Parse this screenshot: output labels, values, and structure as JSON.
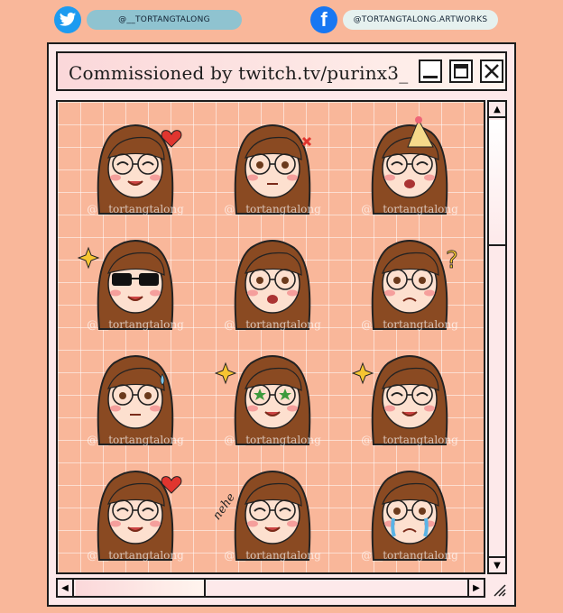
{
  "social": {
    "twitter_handle": "@__TORTANGTALONG",
    "facebook_handle": "@TORTANGTALONG.ARTWORKS",
    "twitter_icon": "twitter-bird-icon",
    "facebook_icon": "facebook-f-icon"
  },
  "window": {
    "title": "Commissioned by twitch.tv/purinx3_",
    "watermark": "@__tortangtalong"
  },
  "colors": {
    "background": "#f9b79a",
    "window": "#fde9ea",
    "hair": "#8a4a22",
    "skin": "#fde0cf",
    "blush": "#f28f8f",
    "heart": "#e0352f",
    "sparkle": "#f6c531"
  },
  "emotes": [
    {
      "name": "heart-cat",
      "mouth": "smile",
      "eyes": "closed",
      "accessory": "heart"
    },
    {
      "name": "angry",
      "mouth": "flat",
      "eyes": "open",
      "accessory": "anger"
    },
    {
      "name": "party",
      "mouth": "open",
      "eyes": "closed",
      "accessory": "hat"
    },
    {
      "name": "cool",
      "mouth": "smile",
      "eyes": "sunglasses",
      "accessory": "sparkle"
    },
    {
      "name": "shocked",
      "mouth": "open",
      "eyes": "open",
      "accessory": "none"
    },
    {
      "name": "confused-cat",
      "mouth": "frown",
      "eyes": "open",
      "accessory": "question"
    },
    {
      "name": "nervous",
      "mouth": "flat",
      "eyes": "open",
      "accessory": "sweat"
    },
    {
      "name": "starstruck",
      "mouth": "smile",
      "eyes": "stars",
      "accessory": "sparkle"
    },
    {
      "name": "happy",
      "mouth": "smile",
      "eyes": "closed",
      "accessory": "sparkle"
    },
    {
      "name": "eating-love",
      "mouth": "smile",
      "eyes": "closed",
      "accessory": "heart"
    },
    {
      "name": "hehe",
      "mouth": "smile",
      "eyes": "closed",
      "accessory": "hehe"
    },
    {
      "name": "crying",
      "mouth": "frown",
      "eyes": "tears",
      "accessory": "none"
    }
  ]
}
